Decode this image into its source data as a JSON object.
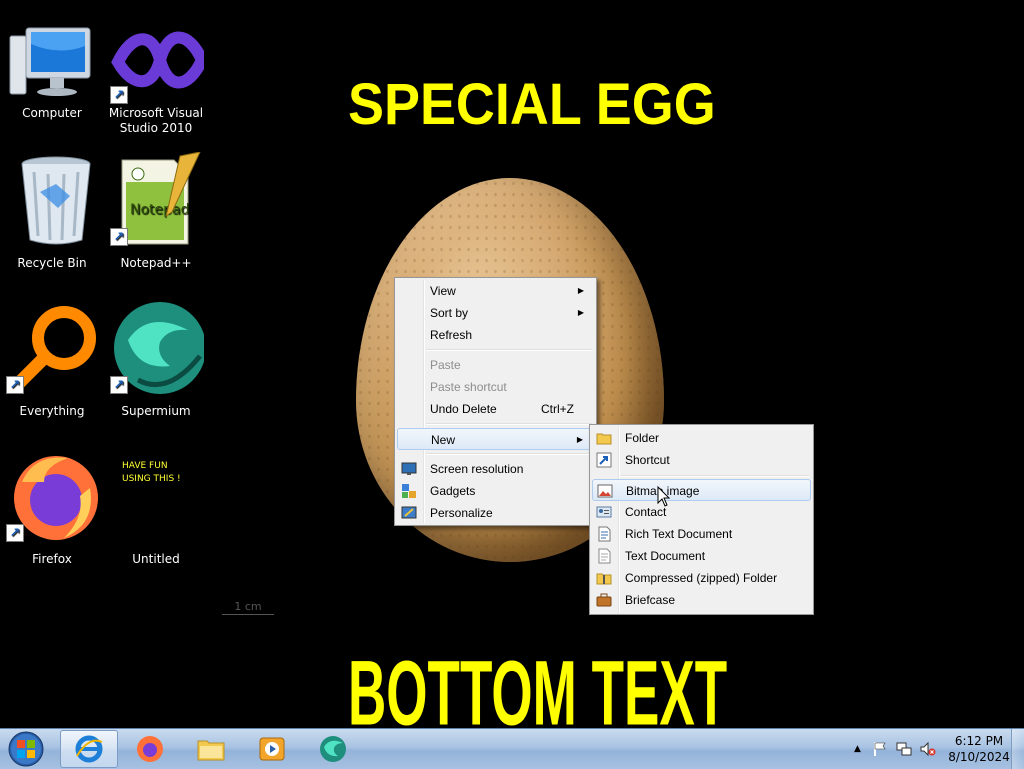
{
  "wallpaper": {
    "top_text": "SPECIAL EGG",
    "bottom_text": "BOTTOM TEXT",
    "ruler_label": "1 cm"
  },
  "desktop_icons": [
    {
      "label": "Computer"
    },
    {
      "label": "Microsoft Visual Studio 2010"
    },
    {
      "label": "Recycle Bin"
    },
    {
      "label": "Notepad++"
    },
    {
      "label": "Everything"
    },
    {
      "label": "Supermium"
    },
    {
      "label": "Firefox"
    },
    {
      "label": "Untitled"
    }
  ],
  "note_text": "HAVE FUN\nUSING THIS !",
  "context_menu": {
    "items": [
      {
        "label": "View",
        "submenu": true
      },
      {
        "label": "Sort by",
        "submenu": true
      },
      {
        "label": "Refresh"
      },
      {
        "label": "Paste",
        "disabled": true
      },
      {
        "label": "Paste shortcut",
        "disabled": true
      },
      {
        "label": "Undo Delete",
        "shortcut": "Ctrl+Z"
      },
      {
        "label": "New",
        "submenu": true,
        "highlighted": true
      },
      {
        "label": "Screen resolution",
        "icon": "monitor-icon"
      },
      {
        "label": "Gadgets",
        "icon": "gadgets-icon"
      },
      {
        "label": "Personalize",
        "icon": "personalize-icon"
      }
    ]
  },
  "new_submenu": {
    "items": [
      {
        "label": "Folder",
        "icon": "folder-icon"
      },
      {
        "label": "Shortcut",
        "icon": "shortcut-icon"
      },
      {
        "label": "Bitmap image",
        "icon": "bitmap-icon",
        "highlighted": true
      },
      {
        "label": "Contact",
        "icon": "contact-icon"
      },
      {
        "label": "Rich Text Document",
        "icon": "rich-text-icon"
      },
      {
        "label": "Text Document",
        "icon": "text-document-icon"
      },
      {
        "label": "Compressed (zipped) Folder",
        "icon": "zip-folder-icon"
      },
      {
        "label": "Briefcase",
        "icon": "briefcase-icon"
      }
    ]
  },
  "taskbar": {
    "pinned": [
      "Internet Explorer",
      "Firefox",
      "Windows Explorer",
      "Windows Media Player",
      "Supermium"
    ],
    "clock_time": "6:12 PM",
    "clock_date": "8/10/2024"
  },
  "colors": {
    "wallpaper_text": "#ffff00",
    "highlight_border": "#aecbf0",
    "menu_bg": "#f0f0f0"
  }
}
